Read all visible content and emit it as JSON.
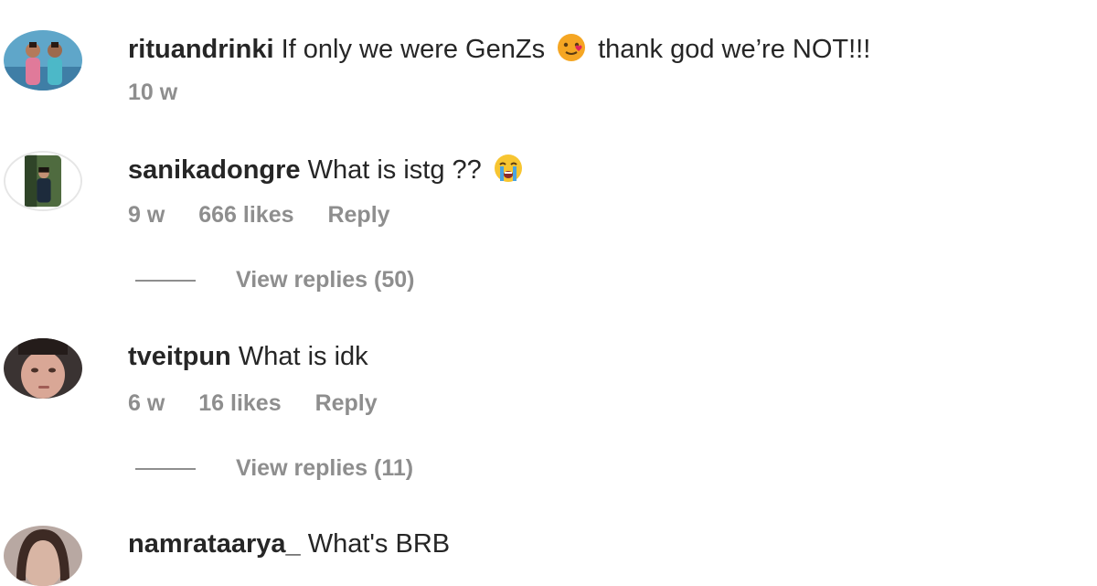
{
  "comments": [
    {
      "username": "rituandrinki",
      "text_before": "If only we were GenZs",
      "emoji": "face-with-heart-emoji",
      "text_after": "thank god we’re NOT!!!",
      "time": "10 w"
    },
    {
      "username": "sanikadongre",
      "text": "What is istg ??",
      "emoji": "loudly-crying-face-emoji",
      "time": "9 w",
      "likes": "666 likes",
      "reply_label": "Reply",
      "view_replies": "View replies (50)"
    },
    {
      "username": "tveitpun",
      "text": "What is idk",
      "time": "6 w",
      "likes": "16 likes",
      "reply_label": "Reply",
      "view_replies": "View replies (11)"
    },
    {
      "username": "namrataarya_",
      "text": "What's BRB"
    }
  ],
  "colors": {
    "primary_text": "#262626",
    "secondary_text": "#8e8e8e",
    "background": "#ffffff"
  }
}
